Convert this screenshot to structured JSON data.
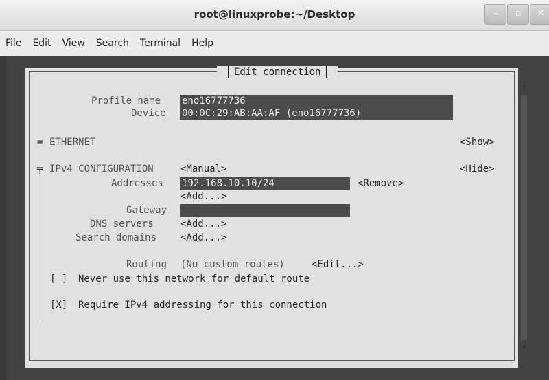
{
  "window": {
    "title": "root@linuxprobe:~/Desktop",
    "btn_minimize": "–",
    "btn_maximize": "▫",
    "btn_close": "✕"
  },
  "menu": {
    "file": "File",
    "edit": "Edit",
    "view": "View",
    "search": "Search",
    "terminal": "Terminal",
    "help": "Help"
  },
  "dialog": {
    "title": "Edit connection",
    "profile_label": "Profile name",
    "profile_value": "eno16777736",
    "device_label": "Device",
    "device_value": "00:0C:29:AB:AA:AF (eno16777736)",
    "ethernet_marker": "=",
    "ethernet_label": "ETHERNET",
    "ethernet_show": "<Show>",
    "ipv4_marker": "╤",
    "ipv4_label": "IPv4 CONFIGURATION",
    "ipv4_mode": "<Manual>",
    "ipv4_hide": "<Hide>",
    "addresses_label": "Addresses",
    "addresses_value": "192.168.10.10/24",
    "remove_label": "<Remove>",
    "add_address": "<Add...>",
    "gateway_label": "Gateway",
    "gateway_value": "",
    "dns_label": "DNS servers",
    "dns_add": "<Add...>",
    "search_domains_label": "Search domains",
    "search_domains_add": "<Add...>",
    "routing_label": "Routing",
    "routing_value": "(No custom routes)",
    "routing_edit": "<Edit...>",
    "never_default_checkbox": "[ ]",
    "never_default_label": "Never use this network for default route",
    "require_ipv4_checkbox": "[X]",
    "require_ipv4_label": "Require IPv4 addressing for this connection",
    "scroll_up": "↑",
    "scroll_down": "↓"
  }
}
